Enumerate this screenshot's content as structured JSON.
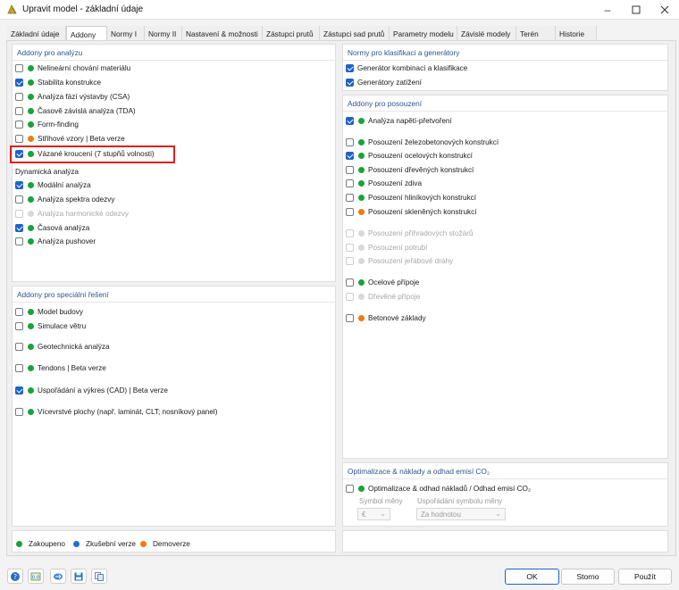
{
  "window": {
    "title": "Upravit model - základní údaje",
    "minimize_icon": "minimize-icon",
    "maximize_icon": "maximize-icon",
    "close_icon": "close-icon"
  },
  "tabs": [
    "Základní údaje",
    "Addony",
    "Normy I",
    "Normy II",
    "Nastavení & možnosti",
    "Zástupci prutů",
    "Zástupci sad prutů",
    "Parametry modelu",
    "Závislé modely",
    "Terén",
    "Historie"
  ],
  "active_tab": "Addony",
  "analysis": {
    "title": "Addony pro analýzu",
    "items": [
      {
        "label": "Nelineární chování materiálu",
        "checked": false,
        "status": "green"
      },
      {
        "label": "Stabilita konstrukce",
        "checked": true,
        "status": "green"
      },
      {
        "label": "Analýza fází výstavby (CSA)",
        "checked": false,
        "status": "green"
      },
      {
        "label": "Časově závislá analýza (TDA)",
        "checked": false,
        "status": "green"
      },
      {
        "label": "Form-finding",
        "checked": false,
        "status": "green"
      },
      {
        "label": "Střihové vzory | Beta verze",
        "checked": false,
        "status": "orange"
      },
      {
        "label": "Vázané kroucení (7 stupňů volnosti)",
        "checked": true,
        "status": "green"
      }
    ],
    "dynamic_title": "Dynamická analýza",
    "dynamic_items": [
      {
        "label": "Modální analýza",
        "checked": true,
        "status": "green",
        "disabled": false
      },
      {
        "label": "Analýza spektra odezvy",
        "checked": false,
        "status": "green",
        "disabled": false
      },
      {
        "label": "Analýza harmonické odezvy",
        "checked": false,
        "status": "grey",
        "disabled": true
      },
      {
        "label": "Časová analýza",
        "checked": true,
        "status": "green",
        "disabled": false
      },
      {
        "label": "Analýza pushover",
        "checked": false,
        "status": "green",
        "disabled": false
      }
    ]
  },
  "special": {
    "title": "Addony pro speciální řešení",
    "items": [
      {
        "label": "Model budovy",
        "checked": false,
        "status": "green"
      },
      {
        "label": "Simulace větru",
        "checked": false,
        "status": "green"
      },
      {
        "label": "Geotechnická analýza",
        "checked": false,
        "status": "green"
      },
      {
        "label": "Tendons | Beta verze",
        "checked": false,
        "status": "green"
      },
      {
        "label": "Uspořádání a výkres (CAD) | Beta verze",
        "checked": true,
        "status": "green"
      },
      {
        "label": "Vícevrstvé plochy (např. laminát, CLT; nosníkový panel)",
        "checked": false,
        "status": "green"
      }
    ]
  },
  "norms": {
    "title": "Normy pro klasifikaci a generátory",
    "items": [
      {
        "label": "Generátor kombinací a klasifikace",
        "checked": true
      },
      {
        "label": "Generátory zatížení",
        "checked": true
      }
    ]
  },
  "design": {
    "title": "Addony pro posouzení",
    "items": [
      {
        "label": "Analýza napětí-přetvoření",
        "checked": true,
        "status": "green",
        "disabled": false
      },
      {
        "label": "Posouzení železobetonových konstrukcí",
        "checked": false,
        "status": "green",
        "disabled": false
      },
      {
        "label": "Posouzení ocelových konstrukcí",
        "checked": true,
        "status": "green",
        "disabled": false
      },
      {
        "label": "Posouzení dřevěných konstrukcí",
        "checked": false,
        "status": "green",
        "disabled": false
      },
      {
        "label": "Posouzení zdiva",
        "checked": false,
        "status": "green",
        "disabled": false
      },
      {
        "label": "Posouzení hliníkových konstrukcí",
        "checked": false,
        "status": "green",
        "disabled": false
      },
      {
        "label": "Posouzení skleněných konstrukcí",
        "checked": false,
        "status": "orange",
        "disabled": false
      },
      {
        "label": "Posouzení příhradových stožárů",
        "checked": false,
        "status": "grey",
        "disabled": true
      },
      {
        "label": "Posouzení potrubí",
        "checked": false,
        "status": "grey",
        "disabled": true
      },
      {
        "label": "Posouzení jeřábové dráhy",
        "checked": false,
        "status": "grey",
        "disabled": true
      },
      {
        "label": "Ocelové přípoje",
        "checked": false,
        "status": "green",
        "disabled": false
      },
      {
        "label": "Dřevěné přípoje",
        "checked": false,
        "status": "grey",
        "disabled": true
      },
      {
        "label": "Betonové základy",
        "checked": false,
        "status": "orange",
        "disabled": false
      }
    ]
  },
  "optimization": {
    "title": "Optimalizace & náklady a odhad emisí CO₂",
    "item": {
      "label": "Optimalizace & odhad nákladů / Odhad emisí CO₂",
      "checked": false,
      "status": "green"
    },
    "currency_label": "Symbol měny",
    "currency_value": "€",
    "symbol_layout_label": "Uspořádání symbolu měny",
    "symbol_layout_value": "Za hodnotou"
  },
  "legend": [
    {
      "label": "Zakoupeno",
      "color": "green"
    },
    {
      "label": "Zkušební verze",
      "color": "blue"
    },
    {
      "label": "Demoverze",
      "color": "orange"
    }
  ],
  "footer": {
    "tools": [
      "help-icon",
      "units-icon",
      "export-icon",
      "save-icon",
      "copy-icon"
    ],
    "ok": "OK",
    "cancel": "Storno",
    "apply": "Použít"
  },
  "colors": {
    "accent": "#1f63c6",
    "green": "#17a33a",
    "orange": "#f07a12",
    "blue": "#1b6fd8",
    "highlight": "#e02020",
    "section_title": "#2e5590"
  }
}
